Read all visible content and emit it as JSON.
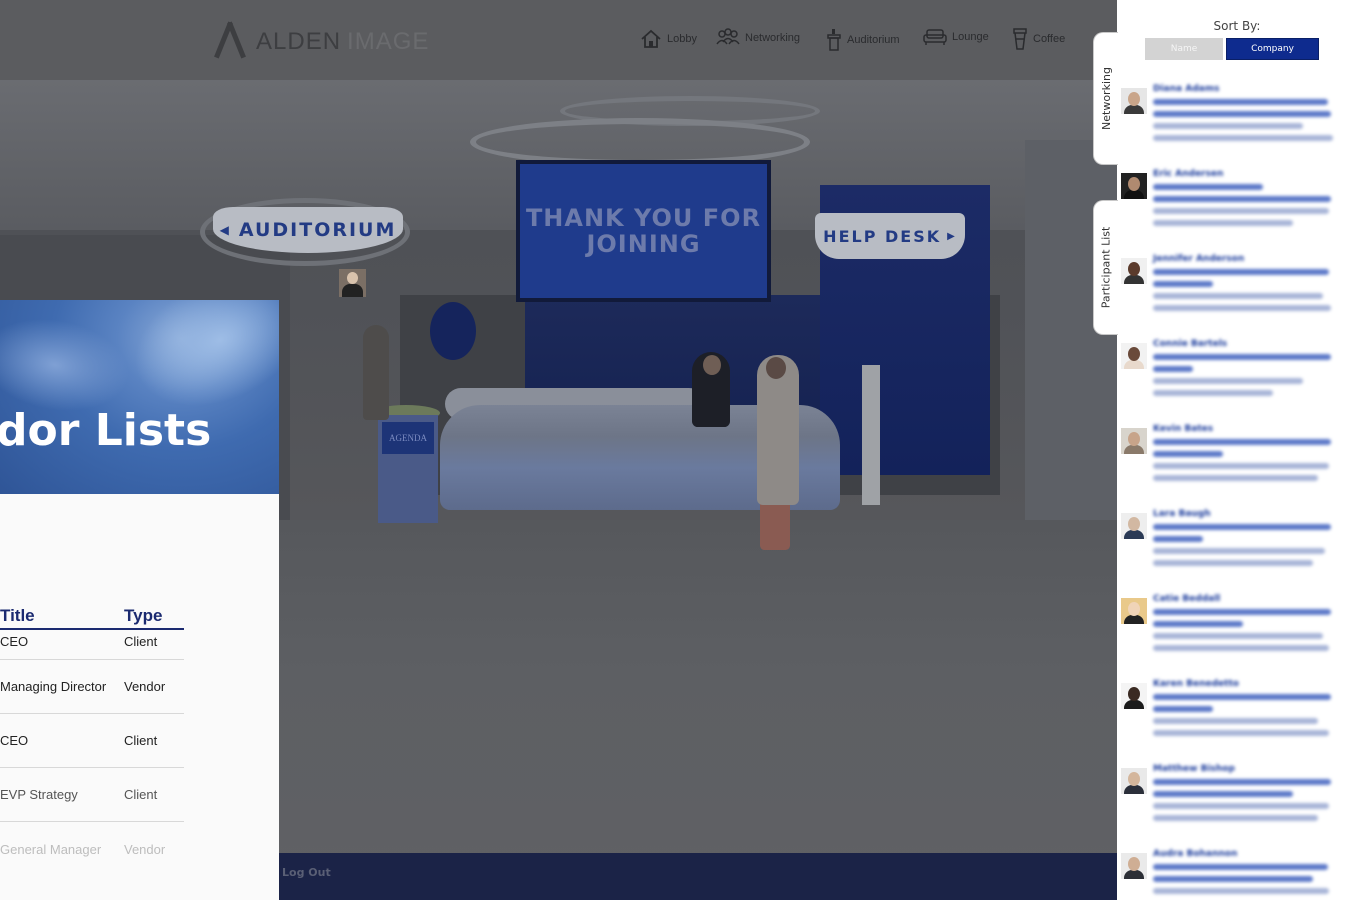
{
  "topbar": {
    "logo_primary": "ALDEN",
    "logo_secondary": "IMAGE",
    "nav": [
      {
        "label": "Lobby",
        "icon": "home-icon"
      },
      {
        "label": "Networking",
        "icon": "people-icon"
      },
      {
        "label": "Auditorium",
        "icon": "podium-icon"
      },
      {
        "label": "Lounge",
        "icon": "sofa-icon"
      },
      {
        "label": "Coffee",
        "icon": "cup-icon"
      }
    ]
  },
  "scene": {
    "screen_text": "THANK YOU FOR JOINING",
    "auditorium_sign": "AUDITORIUM",
    "helpdesk_sign": "HELP DESK",
    "standee_text": "AGENDA"
  },
  "vendor_panel": {
    "title": "dor Lists",
    "columns": [
      "Title",
      "Type"
    ],
    "rows": [
      {
        "title": "CEO",
        "type": "Client"
      },
      {
        "title": "Managing Director",
        "type": "Vendor"
      },
      {
        "title": "CEO",
        "type": "Client"
      },
      {
        "title": "EVP Strategy",
        "type": "Client"
      },
      {
        "title": "General Manager",
        "type": "Vendor"
      }
    ]
  },
  "bottombar": {
    "logout": "Log Out"
  },
  "participant_panel": {
    "tabs": [
      "Networking",
      "Participant List"
    ],
    "sort_label": "Sort By:",
    "sort_options": [
      "Name",
      "Company"
    ],
    "selected_sort": "Company",
    "participants": [
      {
        "name": "Diana Adams"
      },
      {
        "name": "Eric Andersen"
      },
      {
        "name": "Jennifer Anderson"
      },
      {
        "name": "Connie Bartels"
      },
      {
        "name": "Kevin Bates"
      },
      {
        "name": "Lara Baugh"
      },
      {
        "name": "Catie Beddall"
      },
      {
        "name": "Karen Benedetto"
      },
      {
        "name": "Matthew Bishop"
      },
      {
        "name": "Audra Bohannon"
      }
    ]
  },
  "colors": {
    "accent": "#0e2b8e",
    "scene_blue": "#1f3b8c",
    "bottom_bar": "#1b2347"
  }
}
